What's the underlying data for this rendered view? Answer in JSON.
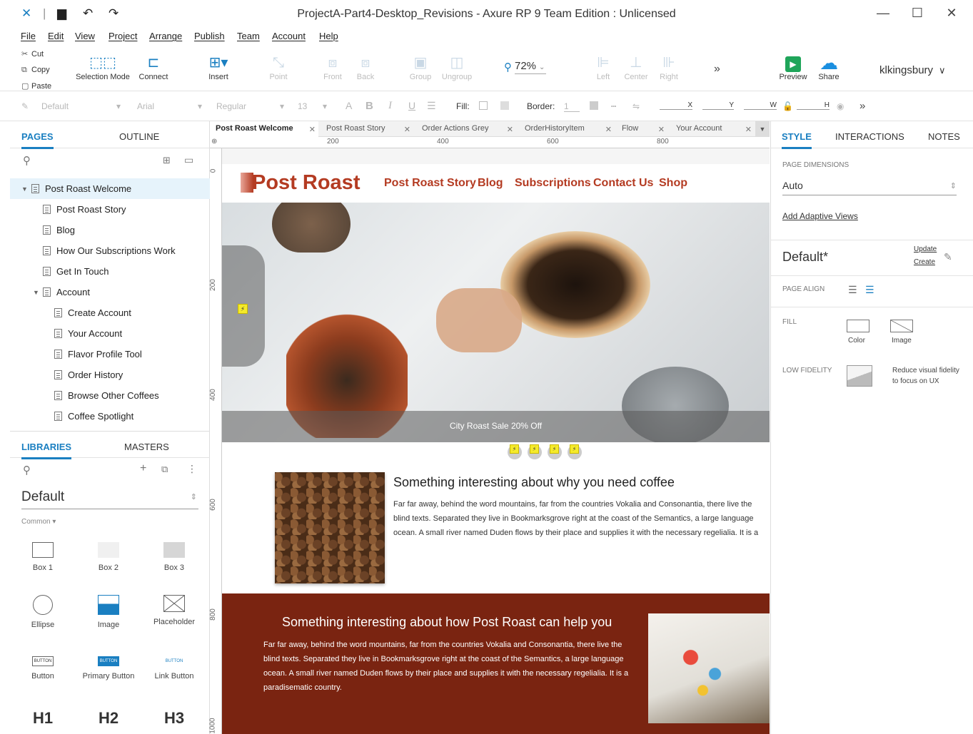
{
  "window": {
    "title": "ProjectA-Part4-Desktop_Revisions - Axure RP 9 Team Edition : Unlicensed"
  },
  "menu": [
    "File",
    "Edit",
    "View",
    "Project",
    "Arrange",
    "Publish",
    "Team",
    "Account",
    "Help"
  ],
  "toolbar": {
    "cut": "Cut",
    "copy": "Copy",
    "paste": "Paste",
    "selection_mode": "Selection Mode",
    "connect": "Connect",
    "insert": "Insert",
    "point": "Point",
    "front": "Front",
    "back": "Back",
    "group": "Group",
    "ungroup": "Ungroup",
    "zoom": "72%",
    "left": "Left",
    "center": "Center",
    "right": "Right",
    "preview": "Preview",
    "share": "Share",
    "user": "klkingsbury"
  },
  "format": {
    "style": "Default",
    "font": "Arial",
    "weight": "Regular",
    "size": "13",
    "fill_label": "Fill:",
    "border_label": "Border:",
    "border_value": "1",
    "x": "X",
    "y": "Y",
    "w": "W",
    "h": "H"
  },
  "pages_panel": {
    "tabs": [
      "PAGES",
      "OUTLINE"
    ],
    "pages": [
      {
        "label": "Post Roast Welcome",
        "level": 0,
        "selected": true,
        "caret": true
      },
      {
        "label": "Post Roast Story",
        "level": 1
      },
      {
        "label": "Blog",
        "level": 1
      },
      {
        "label": "How Our Subscriptions Work",
        "level": 1
      },
      {
        "label": "Get In Touch",
        "level": 1
      },
      {
        "label": "Account",
        "level": 1,
        "caret": true
      },
      {
        "label": "Create Account",
        "level": 2
      },
      {
        "label": "Your Account",
        "level": 2
      },
      {
        "label": "Flavor Profile Tool",
        "level": 2
      },
      {
        "label": "Order History",
        "level": 2
      },
      {
        "label": "Browse Other Coffees",
        "level": 2
      },
      {
        "label": "Coffee Spotlight",
        "level": 2
      }
    ]
  },
  "libraries_panel": {
    "tabs": [
      "LIBRARIES",
      "MASTERS"
    ],
    "library": "Default",
    "category": "Common ▾",
    "items": [
      "Box 1",
      "Box 2",
      "Box 3",
      "Ellipse",
      "Image",
      "Placeholder",
      "Button",
      "Primary Button",
      "Link Button",
      "H1",
      "H2",
      "H3"
    ],
    "button_text": "BUTTON"
  },
  "doc_tabs": [
    "Post Roast Welcome",
    "Post Roast Story",
    "Order Actions Grey",
    "OrderHistoryItem",
    "Flow",
    "Your Account"
  ],
  "rulers": {
    "h": [
      "200",
      "400",
      "600",
      "800"
    ],
    "v": [
      "0",
      "200",
      "400",
      "600",
      "800",
      "1000"
    ]
  },
  "site": {
    "logo": "Post Roast",
    "nav": [
      "Post Roast Story",
      "Blog",
      "Subscriptions",
      "Contact Us",
      "Shop"
    ],
    "hero_caption": "City Roast Sale 20% Off",
    "section1": {
      "heading": "Something interesting about why you need coffee",
      "body": "Far far away, behind the word mountains, far from the countries Vokalia and Consonantia, there live the blind texts. Separated they live in Bookmarksgrove right at the coast of the Semantics, a large language ocean. A small river named Duden flows by their place and supplies it with the necessary regelialia. It is a paradisematic country."
    },
    "section2": {
      "heading": "Something interesting about how Post Roast can help you",
      "body": "Far far away, behind the word mountains, far from the countries Vokalia and Consonantia, there live the blind texts. Separated they live in Bookmarksgrove right at the coast of the Semantics, a large language ocean. A small river named Duden flows by their place and supplies it with the necessary regelialia. It is a paradisematic country."
    },
    "interaction_marker": "⚡"
  },
  "right_panel": {
    "tabs": [
      "STYLE",
      "INTERACTIONS",
      "NOTES"
    ],
    "page_dimensions_label": "PAGE DIMENSIONS",
    "page_dimensions": "Auto",
    "adaptive": "Add Adaptive Views",
    "style_name": "Default*",
    "update": "Update",
    "create": "Create",
    "page_align_label": "PAGE ALIGN",
    "fill_label": "FILL",
    "fill_color": "Color",
    "fill_image": "Image",
    "low_fidelity_label": "LOW FIDELITY",
    "low_fidelity_text": "Reduce visual fidelity to focus on UX"
  },
  "colors": {
    "accent": "#1a7fc1",
    "brand_red": "#b43b22",
    "section_brown": "#7a2411"
  }
}
